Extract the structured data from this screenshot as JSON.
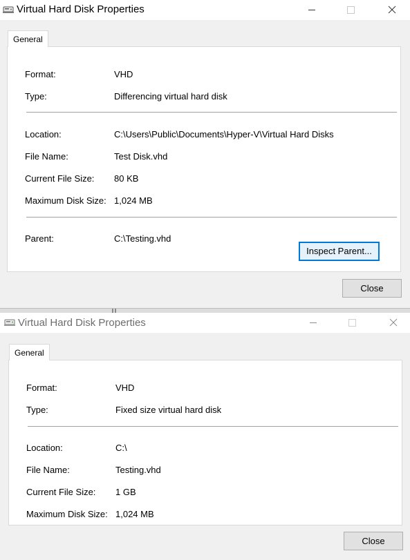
{
  "dialog1": {
    "title": "Virtual Hard Disk Properties",
    "tab_general": "General",
    "format_label": "Format:",
    "format_value": "VHD",
    "type_label": "Type:",
    "type_value": "Differencing virtual hard disk",
    "location_label": "Location:",
    "location_value": "C:\\Users\\Public\\Documents\\Hyper-V\\Virtual Hard Disks",
    "filename_label": "File Name:",
    "filename_value": "Test Disk.vhd",
    "current_size_label": "Current File Size:",
    "current_size_value": "80 KB",
    "max_size_label": "Maximum Disk Size:",
    "max_size_value": "1,024 MB",
    "parent_label": "Parent:",
    "parent_value": "C:\\Testing.vhd",
    "inspect_parent_label": "Inspect Parent...",
    "close_label": "Close"
  },
  "dialog2": {
    "title": "Virtual Hard Disk Properties",
    "tab_general": "General",
    "format_label": "Format:",
    "format_value": "VHD",
    "type_label": "Type:",
    "type_value": "Fixed size virtual hard disk",
    "location_label": "Location:",
    "location_value": "C:\\",
    "filename_label": "File Name:",
    "filename_value": "Testing.vhd",
    "current_size_label": "Current File Size:",
    "current_size_value": "1 GB",
    "max_size_label": "Maximum Disk Size:",
    "max_size_value": "1,024 MB",
    "close_label": "Close"
  },
  "icons": {
    "window": "virtual-disk-icon",
    "minimize": "minimize-icon",
    "maximize": "maximize-icon",
    "close": "close-icon"
  },
  "colors": {
    "focus_border": "#0078d7",
    "button_face": "#e1e1e1",
    "dialog_bg": "#f0f0f0"
  }
}
